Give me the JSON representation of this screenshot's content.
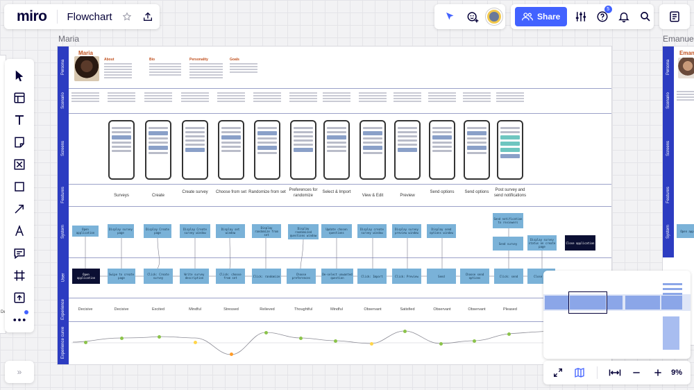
{
  "app": {
    "logo": "miro",
    "board_title": "Flowchart"
  },
  "header": {
    "share_label": "Share",
    "notifications_count": "5"
  },
  "frames": {
    "main_label": "Maria",
    "right_label": "Emanuel"
  },
  "persona": {
    "name": "Maria",
    "sections": [
      "About",
      "Bio",
      "Personality",
      "Goals"
    ],
    "second_name": "Eman"
  },
  "lanes": [
    "Persona",
    "Scenario",
    "Screens",
    "Features",
    "System",
    "User",
    "Experience",
    "Experience curve"
  ],
  "features": [
    "Surveys",
    "Create",
    "Create survey",
    "Choose from set",
    "Randomize from set",
    "Preferences for randomize",
    "Select & Import",
    "View & Edit",
    "Preview",
    "Send options",
    "Send options",
    "Post survey and send notifications"
  ],
  "system_boxes": [
    "Open application",
    "Display survey page",
    "Display Create page",
    "Display Create survey window",
    "Display set window",
    "Display randomize from set",
    "Display randomized questions window",
    "Update chosen questions",
    "Display create survey window",
    "Display survey preview window",
    "Display send options window",
    "Send notification to reviewers",
    "Send survey",
    "Display survey status on create page",
    "Close application"
  ],
  "user_boxes": [
    "Open application",
    "Swipe to create page",
    "Click: Create survey",
    "Write survey description",
    "Click: choose from set",
    "Click: randomize",
    "Choose preferences",
    "De-select unwanted question",
    "Click: Import",
    "Click: Preview",
    "Send",
    "Choose send options",
    "Click: send",
    "Close app"
  ],
  "emotions": [
    "Decisive",
    "Decisive",
    "Excited",
    "Mindful",
    "Stressed",
    "Relieved",
    "Thoughtful",
    "Mindful",
    "Observant",
    "Satisfied",
    "Observant",
    "Observant",
    "Pleased"
  ],
  "left_edge_label": "Deci",
  "zoom": {
    "level": "9%"
  },
  "icons": {
    "star": "star-icon",
    "upload": "upload-icon",
    "reactions": "reactions-icon",
    "settings": "settings-sliders-icon",
    "help": "help-icon",
    "bell": "bell-icon",
    "search": "search-icon",
    "notes": "notes-icon"
  },
  "colors": {
    "accent": "#4262ff",
    "lane": "#2c3cc1",
    "sys_box": "#7ab2d8",
    "dark_box": "#0b0f33",
    "persona_orange": "#c0501e"
  }
}
